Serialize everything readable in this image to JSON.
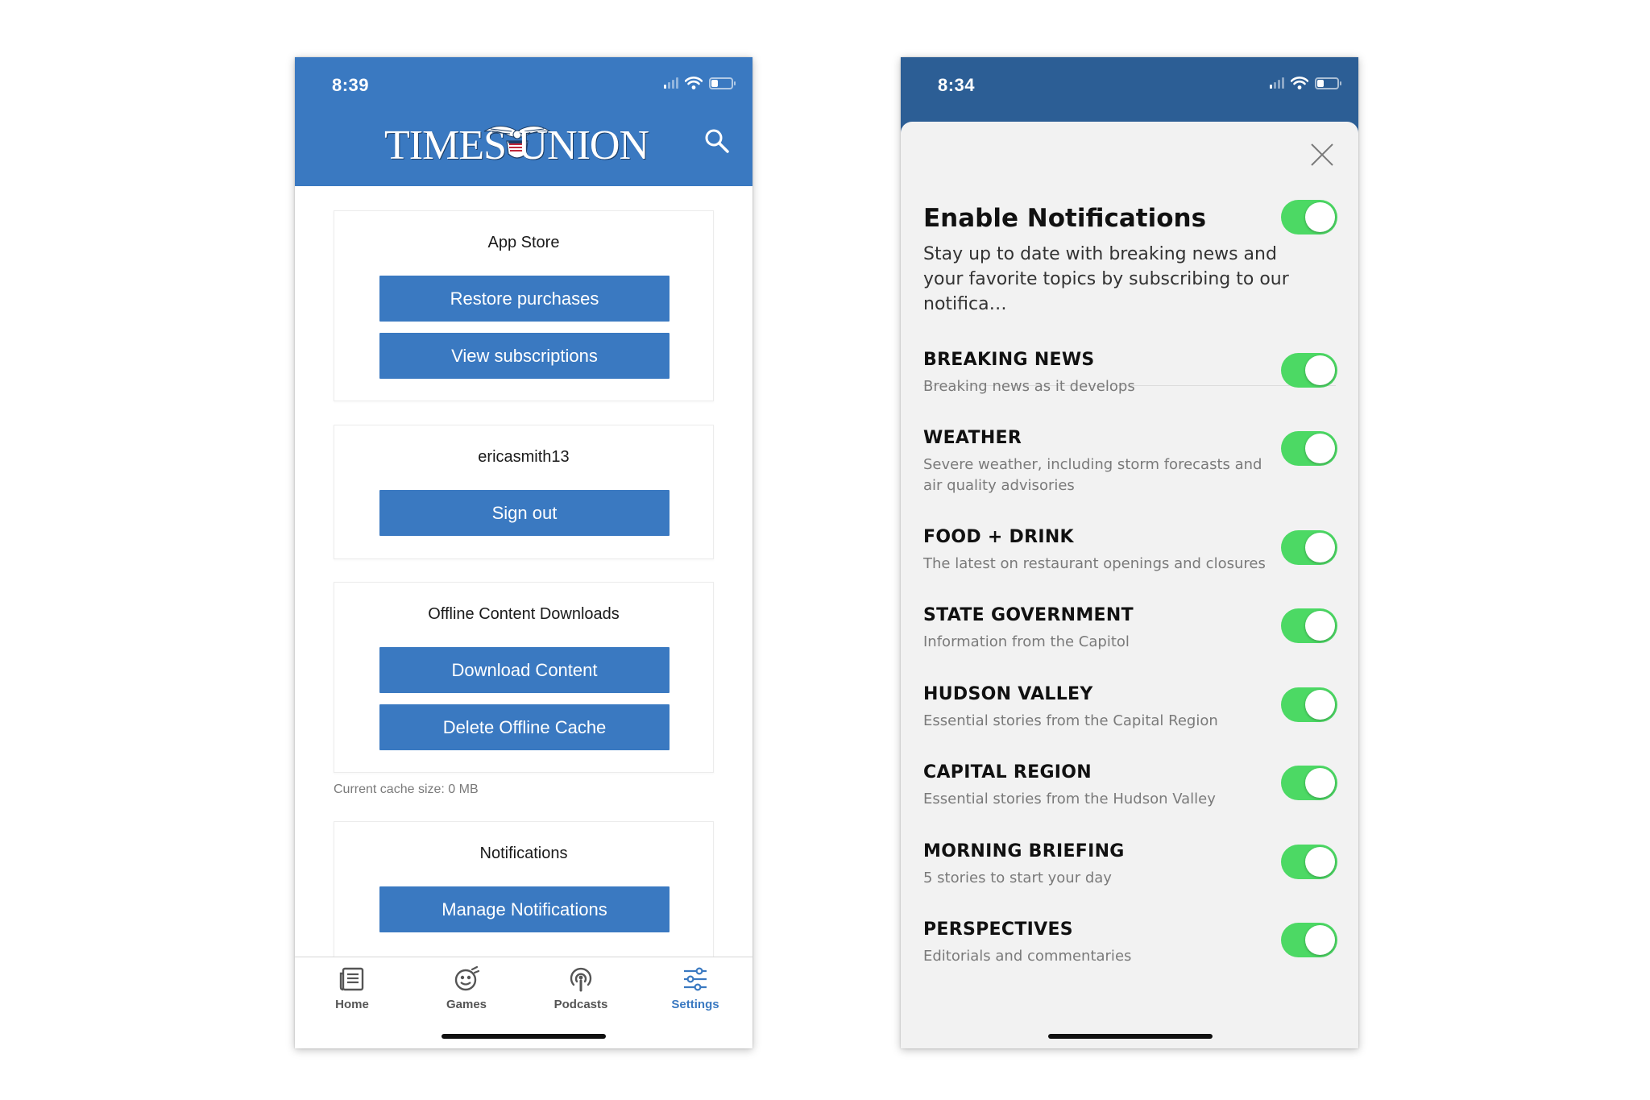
{
  "colors": {
    "brand_blue": "#3a79c1",
    "header_blue_dim": "#2c5e95",
    "toggle_on": "#4cd964",
    "text_dark": "#111111",
    "text_muted": "#7a7a7a"
  },
  "left_phone": {
    "status": {
      "time": "8:39",
      "signal_bars_on": 1,
      "battery_level": 0.25
    },
    "header": {
      "logo_left": "TIMES",
      "logo_right": "UNION",
      "logo_icon": "eagle-seal-icon",
      "search_icon": "search-icon"
    },
    "sections": [
      {
        "title": "App Store",
        "buttons": [
          "Restore purchases",
          "View subscriptions"
        ]
      },
      {
        "title": "ericasmith13",
        "buttons": [
          "Sign out"
        ]
      },
      {
        "title": "Offline Content Downloads",
        "buttons": [
          "Download Content",
          "Delete Offline Cache"
        ]
      },
      {
        "title": "Notifications",
        "buttons": [
          "Manage Notifications"
        ]
      }
    ],
    "cache_note": "Current cache size: 0 MB",
    "tabs": [
      {
        "label": "Home",
        "icon": "newspaper-icon",
        "active": false
      },
      {
        "label": "Games",
        "icon": "games-icon",
        "active": false
      },
      {
        "label": "Podcasts",
        "icon": "podcast-icon",
        "active": false
      },
      {
        "label": "Settings",
        "icon": "sliders-icon",
        "active": true
      }
    ]
  },
  "right_phone": {
    "status": {
      "time": "8:34",
      "signal_bars_on": 1,
      "battery_level": 0.25
    },
    "close_icon": "close-icon",
    "title": "Enable Notifications",
    "enabled": true,
    "description": "Stay up to date with breaking news and your favorite topics by subscribing to our notifica…",
    "topics": [
      {
        "title": "BREAKING NEWS",
        "description": "Breaking news as it develops",
        "enabled": true
      },
      {
        "title": "WEATHER",
        "description": "Severe weather, including storm forecasts and air quality advisories",
        "enabled": true
      },
      {
        "title": "FOOD + DRINK",
        "description": "The latest on restaurant openings and closures",
        "enabled": true
      },
      {
        "title": "STATE GOVERNMENT",
        "description": "Information from the Capitol",
        "enabled": true
      },
      {
        "title": "HUDSON VALLEY",
        "description": "Essential stories from the Capital Region",
        "enabled": true
      },
      {
        "title": "CAPITAL REGION",
        "description": "Essential stories from the Hudson Valley",
        "enabled": true
      },
      {
        "title": "MORNING BRIEFING",
        "description": "5 stories to start your day",
        "enabled": true
      },
      {
        "title": "PERSPECTIVES",
        "description": "Editorials and commentaries",
        "enabled": true
      }
    ]
  }
}
